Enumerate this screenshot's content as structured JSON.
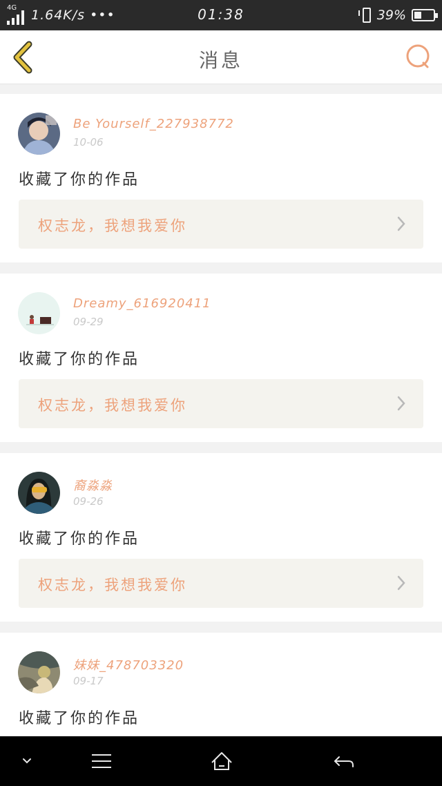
{
  "status_bar": {
    "network": "4G",
    "speed": "1.64K/s •••",
    "time": "01:38",
    "battery_percent_text": "39%",
    "battery_level": 0.39
  },
  "header": {
    "title": "消息",
    "back_icon": "chevron-left-icon",
    "search_icon": "search-icon"
  },
  "messages": [
    {
      "username": "Be Yourself_227938772",
      "date": "10-06",
      "action": "收藏了你的作品",
      "work_title": "权志龙，我想我爱你"
    },
    {
      "username": "Dreamy_616920411",
      "date": "09-29",
      "action": "收藏了你的作品",
      "work_title": "权志龙，我想我爱你"
    },
    {
      "username": "裔淼淼",
      "date": "09-26",
      "action": "收藏了你的作品",
      "work_title": "权志龙，我想我爱你"
    },
    {
      "username": "妹妹_478703320",
      "date": "09-17",
      "action": "收藏了你的作品"
    }
  ],
  "colors": {
    "accent": "#eda27b",
    "back_icon": "#e2c23f",
    "link_bg": "#f4f3ee",
    "status_bar_bg": "#2a2a2a",
    "nav_bar_bg": "#000000"
  },
  "system_nav": {
    "icons": [
      "chevron-down-icon",
      "menu-icon",
      "home-icon",
      "back-arrow-icon"
    ]
  }
}
